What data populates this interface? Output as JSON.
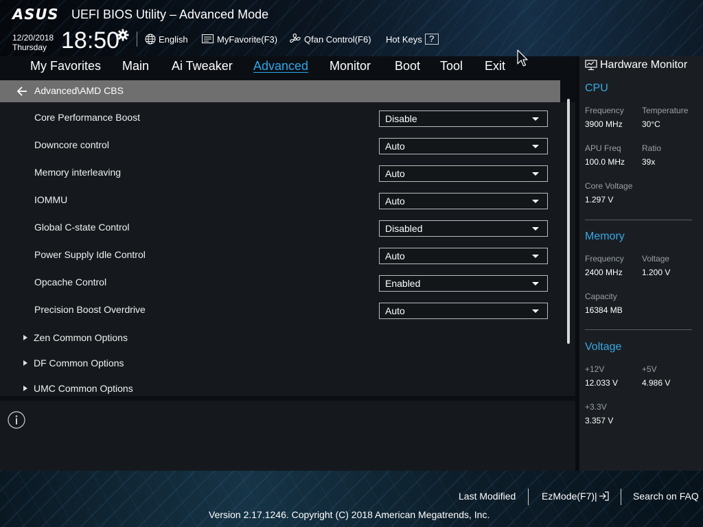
{
  "header": {
    "brand": "ASUS",
    "title": "UEFI BIOS Utility – Advanced Mode",
    "date": "12/20/2018",
    "day": "Thursday",
    "time": "18:50",
    "language": "English",
    "my_favorite": "MyFavorite(F3)",
    "qfan": "Qfan Control(F6)",
    "hot_keys": "Hot Keys",
    "hot_keys_symbol": "?"
  },
  "menu": {
    "tabs": [
      "My Favorites",
      "Main",
      "Ai Tweaker",
      "Advanced",
      "Monitor",
      "Boot",
      "Tool",
      "Exit"
    ],
    "active": "Advanced"
  },
  "breadcrumb": "Advanced\\AMD CBS",
  "settings": [
    {
      "label": "Core Performance Boost",
      "value": "Disable"
    },
    {
      "label": "Downcore control",
      "value": "Auto"
    },
    {
      "label": "Memory interleaving",
      "value": "Auto"
    },
    {
      "label": "IOMMU",
      "value": "Auto"
    },
    {
      "label": "Global C-state Control",
      "value": "Disabled"
    },
    {
      "label": "Power Supply Idle Control",
      "value": "Auto"
    },
    {
      "label": "Opcache Control",
      "value": "Enabled"
    },
    {
      "label": "Precision Boost Overdrive",
      "value": "Auto"
    }
  ],
  "submenus": [
    "Zen Common Options",
    "DF Common Options",
    "UMC Common Options"
  ],
  "hardware_monitor": {
    "title": "Hardware Monitor",
    "cpu": {
      "heading": "CPU",
      "frequency_label": "Frequency",
      "frequency": "3900 MHz",
      "temperature_label": "Temperature",
      "temperature": "30°C",
      "apu_freq_label": "APU Freq",
      "apu_freq": "100.0 MHz",
      "ratio_label": "Ratio",
      "ratio": "39x",
      "core_voltage_label": "Core Voltage",
      "core_voltage": "1.297 V"
    },
    "memory": {
      "heading": "Memory",
      "frequency_label": "Frequency",
      "frequency": "2400 MHz",
      "voltage_label": "Voltage",
      "voltage": "1.200 V",
      "capacity_label": "Capacity",
      "capacity": "16384 MB"
    },
    "voltage": {
      "heading": "Voltage",
      "v12_label": "+12V",
      "v12": "12.033 V",
      "v5_label": "+5V",
      "v5": "4.986 V",
      "v33_label": "+3.3V",
      "v33": "3.357 V"
    }
  },
  "footer": {
    "last_modified": "Last Modified",
    "ezmode": "EzMode(F7)|",
    "search_faq": "Search on FAQ",
    "copyright": "Version 2.17.1246. Copyright (C) 2018 American Megatrends, Inc."
  },
  "colors": {
    "accent": "#2ea8e8",
    "breadcrumb_bg": "#6f6f6f",
    "panel_bg": "#15191d"
  }
}
